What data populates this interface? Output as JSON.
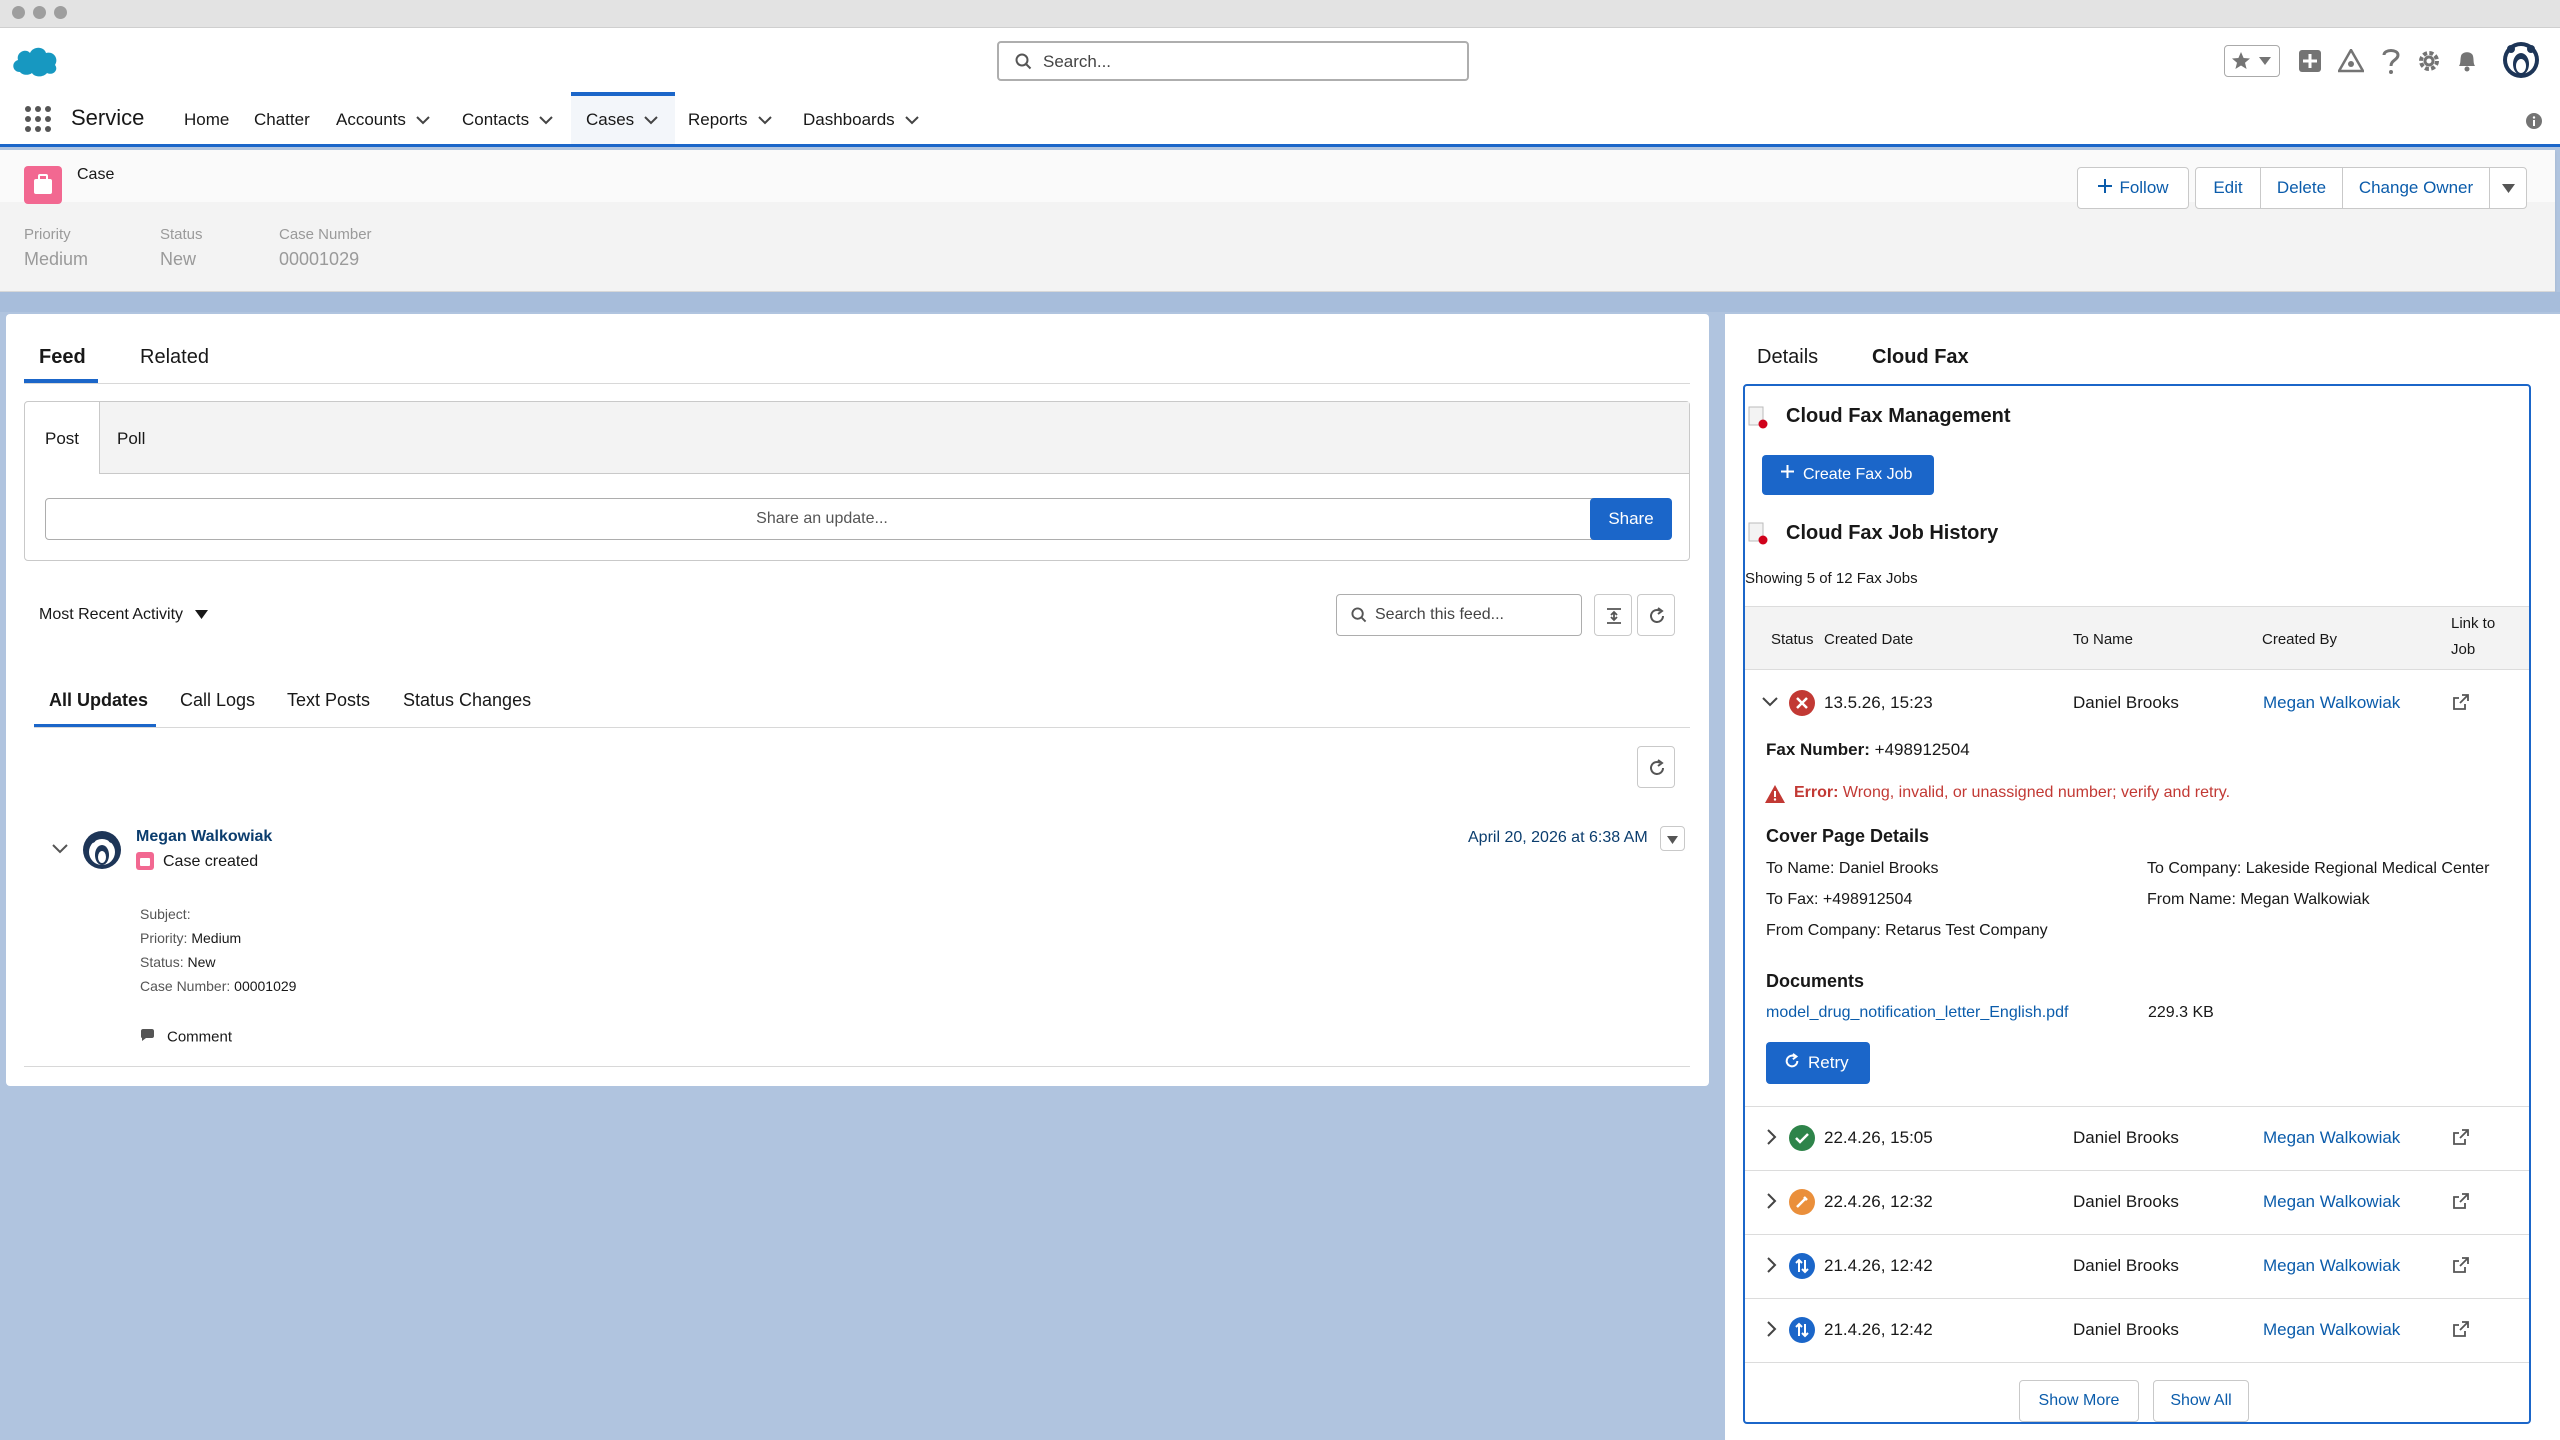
{
  "global": {
    "search_placeholder": "Search..."
  },
  "nav": {
    "app_name": "Service",
    "items": [
      {
        "label": "Home",
        "dropdown": false
      },
      {
        "label": "Chatter",
        "dropdown": false
      },
      {
        "label": "Accounts",
        "dropdown": true
      },
      {
        "label": "Contacts",
        "dropdown": true
      },
      {
        "label": "Cases",
        "dropdown": true,
        "active": true
      },
      {
        "label": "Reports",
        "dropdown": true
      },
      {
        "label": "Dashboards",
        "dropdown": true
      }
    ]
  },
  "record": {
    "object_label": "Case",
    "buttons": {
      "follow": "Follow",
      "edit": "Edit",
      "delete": "Delete",
      "change_owner": "Change Owner"
    },
    "fields": [
      {
        "label": "Priority",
        "value": "Medium"
      },
      {
        "label": "Status",
        "value": "New"
      },
      {
        "label": "Case Number",
        "value": "00001029"
      }
    ]
  },
  "feed": {
    "tabs": [
      "Feed",
      "Related"
    ],
    "publisher_tabs": [
      "Post",
      "Poll"
    ],
    "share_placeholder": "Share an update...",
    "share_button": "Share",
    "sort_label": "Most Recent Activity",
    "search_placeholder": "Search this feed...",
    "filter_tabs": [
      "All Updates",
      "Call Logs",
      "Text Posts",
      "Status Changes"
    ],
    "post": {
      "author": "Megan Walkowiak",
      "action": "Case created",
      "timestamp": "April 20, 2026 at 6:38 AM",
      "details": [
        {
          "label": "Subject:",
          "value": ""
        },
        {
          "label": "Priority:",
          "value": "Medium"
        },
        {
          "label": "Status:",
          "value": "New"
        },
        {
          "label": "Case Number:",
          "value": "00001029"
        }
      ],
      "comment_label": "Comment"
    }
  },
  "right_panel": {
    "tabs": [
      "Details",
      "Cloud Fax"
    ],
    "management_title": "Cloud Fax Management",
    "create_button": "Create Fax Job",
    "history_title": "Cloud Fax Job History",
    "showing_text": "Showing 5 of 12 Fax Jobs",
    "columns": {
      "status": "Status",
      "created_date": "Created Date",
      "to_name": "To Name",
      "created_by": "Created By",
      "link_line1": "Link to",
      "link_line2": "Job"
    },
    "expanded": {
      "date": "13.5.26, 15:23",
      "to_name": "Daniel Brooks",
      "created_by": "Megan Walkowiak",
      "fax_number_label": "Fax Number:",
      "fax_number": "+498912504",
      "error_label": "Error:",
      "error_text": "Wrong, invalid, or unassigned number; verify and retry.",
      "cover_title": "Cover Page Details",
      "to_name_line": "To Name: Daniel Brooks",
      "to_company_line": "To Company: Lakeside Regional Medical Center",
      "to_fax_line": "To Fax: +498912504",
      "from_name_line": "From Name: Megan Walkowiak",
      "from_company_line": "From Company: Retarus Test Company",
      "documents_title": "Documents",
      "document_name": "model_drug_notification_letter_English.pdf",
      "document_size": "229.3 KB",
      "retry_button": "Retry"
    },
    "rows": [
      {
        "status": "success",
        "date": "22.4.26, 15:05",
        "to_name": "Daniel Brooks",
        "created_by": "Megan Walkowiak"
      },
      {
        "status": "pending",
        "date": "22.4.26, 12:32",
        "to_name": "Daniel Brooks",
        "created_by": "Megan Walkowiak"
      },
      {
        "status": "in-progress",
        "date": "21.4.26, 12:42",
        "to_name": "Daniel Brooks",
        "created_by": "Megan Walkowiak"
      },
      {
        "status": "in-progress",
        "date": "21.4.26, 12:42",
        "to_name": "Daniel Brooks",
        "created_by": "Megan Walkowiak"
      }
    ],
    "show_more": "Show More",
    "show_all": "Show All"
  },
  "colors": {
    "brand": "#1b66c9",
    "link": "#0b5cab",
    "error": "#c23934",
    "success": "#2e844a",
    "pending": "#ea8f3b",
    "case_icon": "#f26891"
  }
}
